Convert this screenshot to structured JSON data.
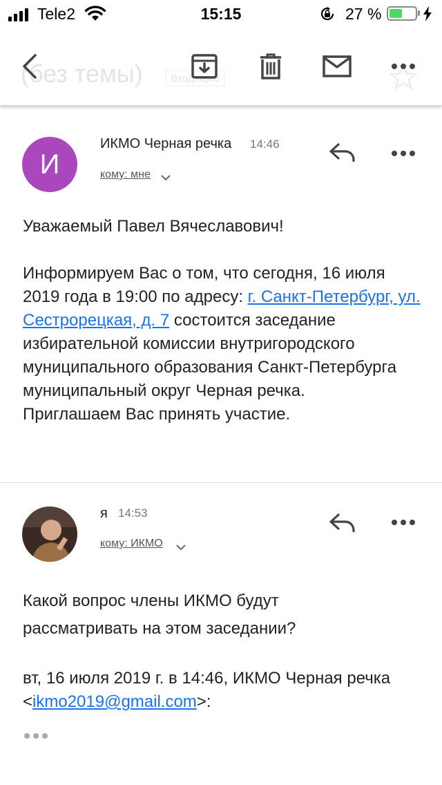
{
  "status_bar": {
    "carrier": "Tele2",
    "time": "15:15",
    "battery_percent": "27 %",
    "battery_level": 0.27
  },
  "toolbar": {
    "ghost_subject": "(без темы)",
    "ghost_label": "Входящие",
    "icons": [
      "back-icon",
      "archive-icon",
      "trash-icon",
      "mail-icon",
      "more-icon"
    ]
  },
  "messages": [
    {
      "avatar_letter": "И",
      "avatar_color": "#ab47bc",
      "sender": "ИКМО Черная речка",
      "time": "14:46",
      "recipient": "кому: мне",
      "greeting": "Уважаемый Павел Вячеславович!",
      "body_before_link": "Информируем Вас о том, что сегодня, 16 июля 2019 года в 19:00 по адресу: ",
      "address_link": "г. Санкт-Петербург, ул. Сестрорецкая, д. 7",
      "body_after_link": " состоится заседание избирательной комиссии внутригородского муниципального образования Санкт-Петербурга муниципальный округ Черная речка.",
      "closing": "Приглашаем Вас принять участие."
    },
    {
      "sender": "я",
      "time": "14:53",
      "recipient": "кому: ИКМО",
      "question": "Какой вопрос члены ИКМО будут рассматривать на этом заседании?",
      "quote_prefix": "вт, 16 июля 2019 г. в 14:46, ИКМО Черная речка <",
      "quote_email": "ikmo2019@gmail.com",
      "quote_suffix": ">:"
    }
  ],
  "colors": {
    "link": "#1a73e8",
    "battery_fill": "#4cd964"
  }
}
